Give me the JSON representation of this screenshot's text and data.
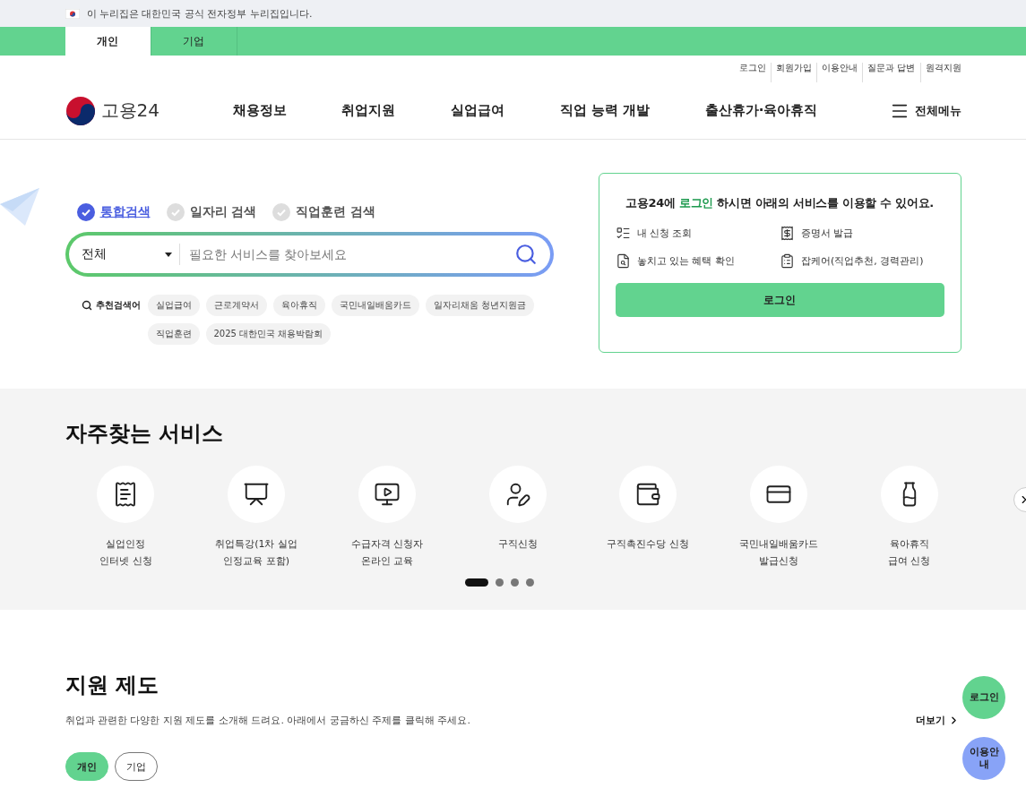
{
  "gov_banner": {
    "text": "이 누리집은 대한민국 공식 전자정부 누리집입니다."
  },
  "audience_tabs": [
    {
      "label": "개인",
      "selected": true
    },
    {
      "label": "기업",
      "selected": false
    }
  ],
  "utility_links": [
    "로그인",
    "회원가입",
    "이용안내",
    "질문과 답변",
    "원격지원"
  ],
  "logo": {
    "text": "고용24"
  },
  "nav": [
    "채용정보",
    "취업지원",
    "실업급여",
    "직업 능력 개발",
    "출산휴가·육아휴직"
  ],
  "all_menu": "전체메뉴",
  "search": {
    "types": [
      {
        "label": "통합검색",
        "selected": true
      },
      {
        "label": "일자리 검색",
        "selected": false
      },
      {
        "label": "직업훈련 검색",
        "selected": false
      }
    ],
    "category": "전체",
    "placeholder": "필요한 서비스를 찾아보세요",
    "recommended_label": "추천검색어",
    "recommended": [
      "실업급여",
      "근로계약서",
      "육아휴직",
      "국민내일배움카드",
      "일자리채움 청년지원금",
      "직업훈련",
      "2025 대한민국 채용박람회"
    ]
  },
  "login_card": {
    "title": "고용24에 **로그인** 하시면 아래의 서비스를 이용할 수 있어요.",
    "services": [
      "내 신청 조회",
      "증명서 발급",
      "놓치고 있는 혜택 확인",
      "잡케어(직업추천, 경력관리)"
    ],
    "button": "로그인"
  },
  "frequent_services": {
    "title": "자주찾는 서비스",
    "items": [
      {
        "lines": [
          "실업인정",
          "인터넷 신청"
        ]
      },
      {
        "lines": [
          "취업특강(1차 실업",
          "인정교육 포함)"
        ]
      },
      {
        "lines": [
          "수급자격 신청자",
          "온라인 교육"
        ]
      },
      {
        "lines": [
          "구직신청"
        ]
      },
      {
        "lines": [
          "구직촉진수당 신청"
        ]
      },
      {
        "lines": [
          "국민내일배움카드",
          "발급신청"
        ]
      },
      {
        "lines": [
          "육아휴직",
          "급여 신청"
        ]
      }
    ],
    "pages": [
      {
        "selected": true
      },
      {
        "selected": false
      },
      {
        "selected": false
      },
      {
        "selected": false
      }
    ]
  },
  "support": {
    "title": "지원 제도",
    "description": "취업과 관련한 다양한 지원 제도를 소개해 드려요. 아래에서 궁금하신 주제를 클릭해 주세요.",
    "more": "더보기",
    "tabs": [
      {
        "label": "개인",
        "selected": true
      },
      {
        "label": "기업",
        "selected": false
      }
    ]
  },
  "floating": [
    {
      "label": "로그인",
      "kind": "login"
    },
    {
      "label": "이용안내",
      "kind": "guide"
    }
  ]
}
